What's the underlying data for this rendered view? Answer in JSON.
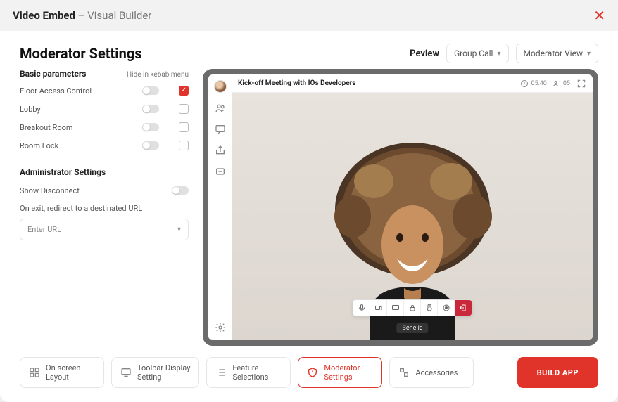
{
  "titlebar": {
    "app": "Video Embed",
    "sep": " – ",
    "sub": "Visual Builder"
  },
  "page": {
    "title": "Moderator Settings"
  },
  "preview": {
    "label": "Peview",
    "mode": "Group Call",
    "view": "Moderator View"
  },
  "basic": {
    "heading": "Basic parameters",
    "hide_heading": "Hide in kebab menu",
    "items": [
      {
        "label": "Floor Access Control",
        "toggle": false,
        "hide_checked": true
      },
      {
        "label": "Lobby",
        "toggle": false,
        "hide_checked": false
      },
      {
        "label": "Breakout Room",
        "toggle": false,
        "hide_checked": false
      },
      {
        "label": "Room Lock",
        "toggle": false,
        "hide_checked": false
      }
    ]
  },
  "admin": {
    "heading": "Administrator Settings",
    "show_disconnect_label": "Show Disconnect",
    "redirect_label": "On exit, redirect to a destinated URL",
    "url_placeholder": "Enter URL"
  },
  "meeting": {
    "title": "Kick-off Meeting with IOs Developers",
    "time": "05:40",
    "participants": "05",
    "speaker": "Benelia"
  },
  "footer": {
    "tabs": [
      {
        "key": "layout",
        "label": "On-screen\nLayout"
      },
      {
        "key": "toolbar",
        "label": "Toolbar Display\nSetting"
      },
      {
        "key": "features",
        "label": "Feature\nSelections"
      },
      {
        "key": "moderator",
        "label": "Moderator\nSettings"
      },
      {
        "key": "accessories",
        "label": "Accessories"
      }
    ],
    "build": "BUILD APP"
  }
}
